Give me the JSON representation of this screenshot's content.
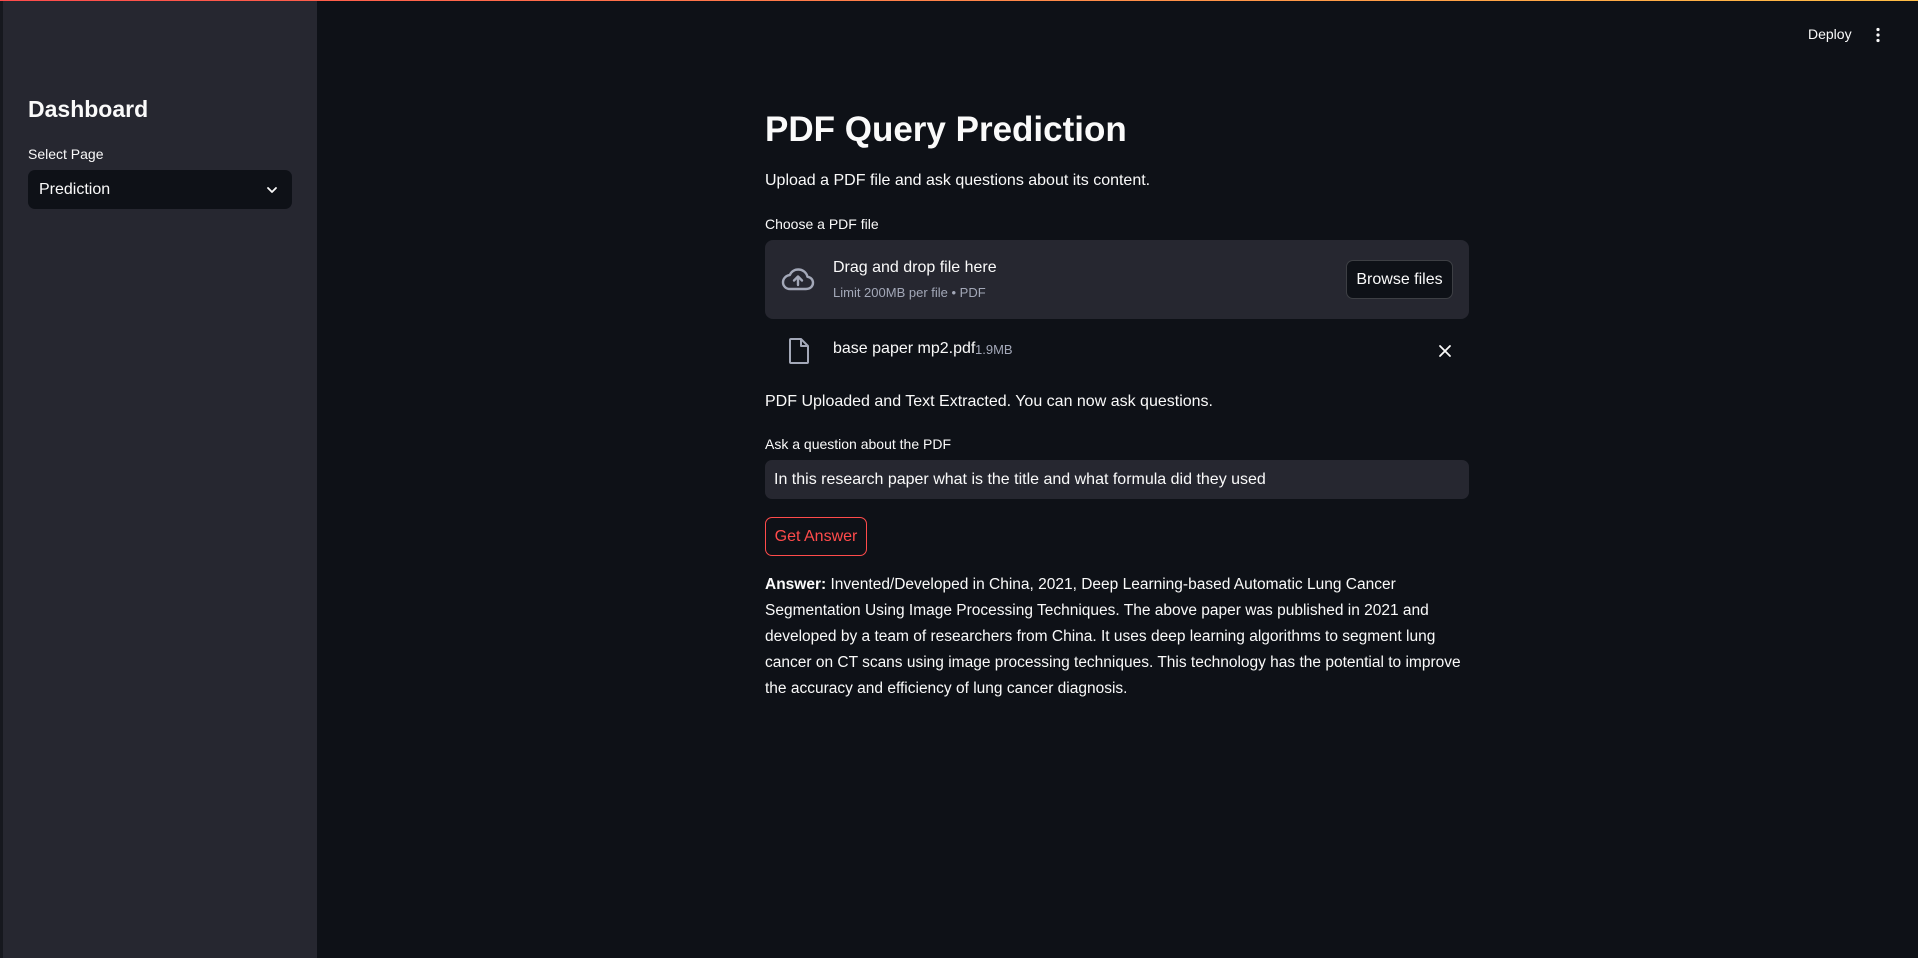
{
  "header": {
    "deploy_label": "Deploy"
  },
  "sidebar": {
    "title": "Dashboard",
    "select_label": "Select Page",
    "select_value": "Prediction"
  },
  "main": {
    "title": "PDF Query Prediction",
    "subtitle": "Upload a PDF file and ask questions about its content.",
    "uploader": {
      "label": "Choose a PDF file",
      "dropzone_title": "Drag and drop file here",
      "dropzone_hint": "Limit 200MB per file • PDF",
      "browse_label": "Browse files"
    },
    "uploaded_file": {
      "name": "base paper mp2.pdf",
      "size": "1.9MB"
    },
    "status": "PDF Uploaded and Text Extracted. You can now ask questions.",
    "question": {
      "label": "Ask a question about the PDF",
      "value": "In this research paper what is the title and what formula did they used"
    },
    "get_answer_label": "Get Answer",
    "answer": {
      "label": "Answer:",
      "text": "Invented/Developed in China, 2021, Deep Learning-based Automatic Lung Cancer Segmentation Using Image Processing Techniques. The above paper was published in 2021 and developed by a team of researchers from China. It uses deep learning algorithms to segment lung cancer on CT scans using image processing techniques. This technology has the potential to improve the accuracy and efficiency of lung cancer diagnosis."
    }
  },
  "icons": {
    "select": "chevron-down-icon",
    "menu": "kebab-menu-icon",
    "upload": "cloud-upload-icon",
    "file": "file-icon",
    "remove": "close-icon"
  },
  "colors": {
    "background": "#0e1117",
    "sidebar": "#262730",
    "accent": "#ff4b4b",
    "text": "#fafafa",
    "muted": "#a3a8b8"
  }
}
